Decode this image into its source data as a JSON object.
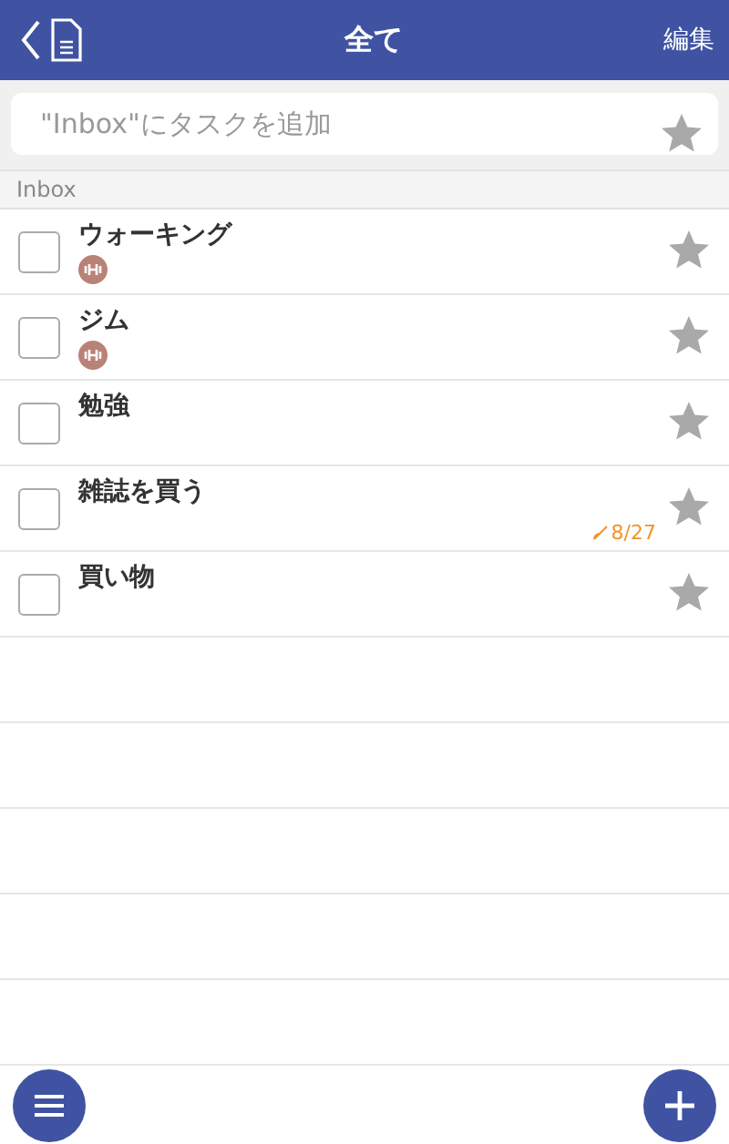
{
  "header": {
    "title": "全て",
    "edit": "編集"
  },
  "add_field": {
    "placeholder": "\"Inbox\"にタスクを追加",
    "starred": false
  },
  "section": "Inbox",
  "tasks": [
    {
      "title": "ウォーキング",
      "checked": false,
      "starred": false,
      "badge": true
    },
    {
      "title": "ジム",
      "checked": false,
      "starred": false,
      "badge": true
    },
    {
      "title": "勉強",
      "checked": false,
      "starred": false,
      "badge": false
    },
    {
      "title": "雑誌を買う",
      "checked": false,
      "starred": false,
      "badge": false,
      "due": "8/27"
    },
    {
      "title": "買い物",
      "checked": false,
      "starred": false,
      "badge": false
    }
  ]
}
